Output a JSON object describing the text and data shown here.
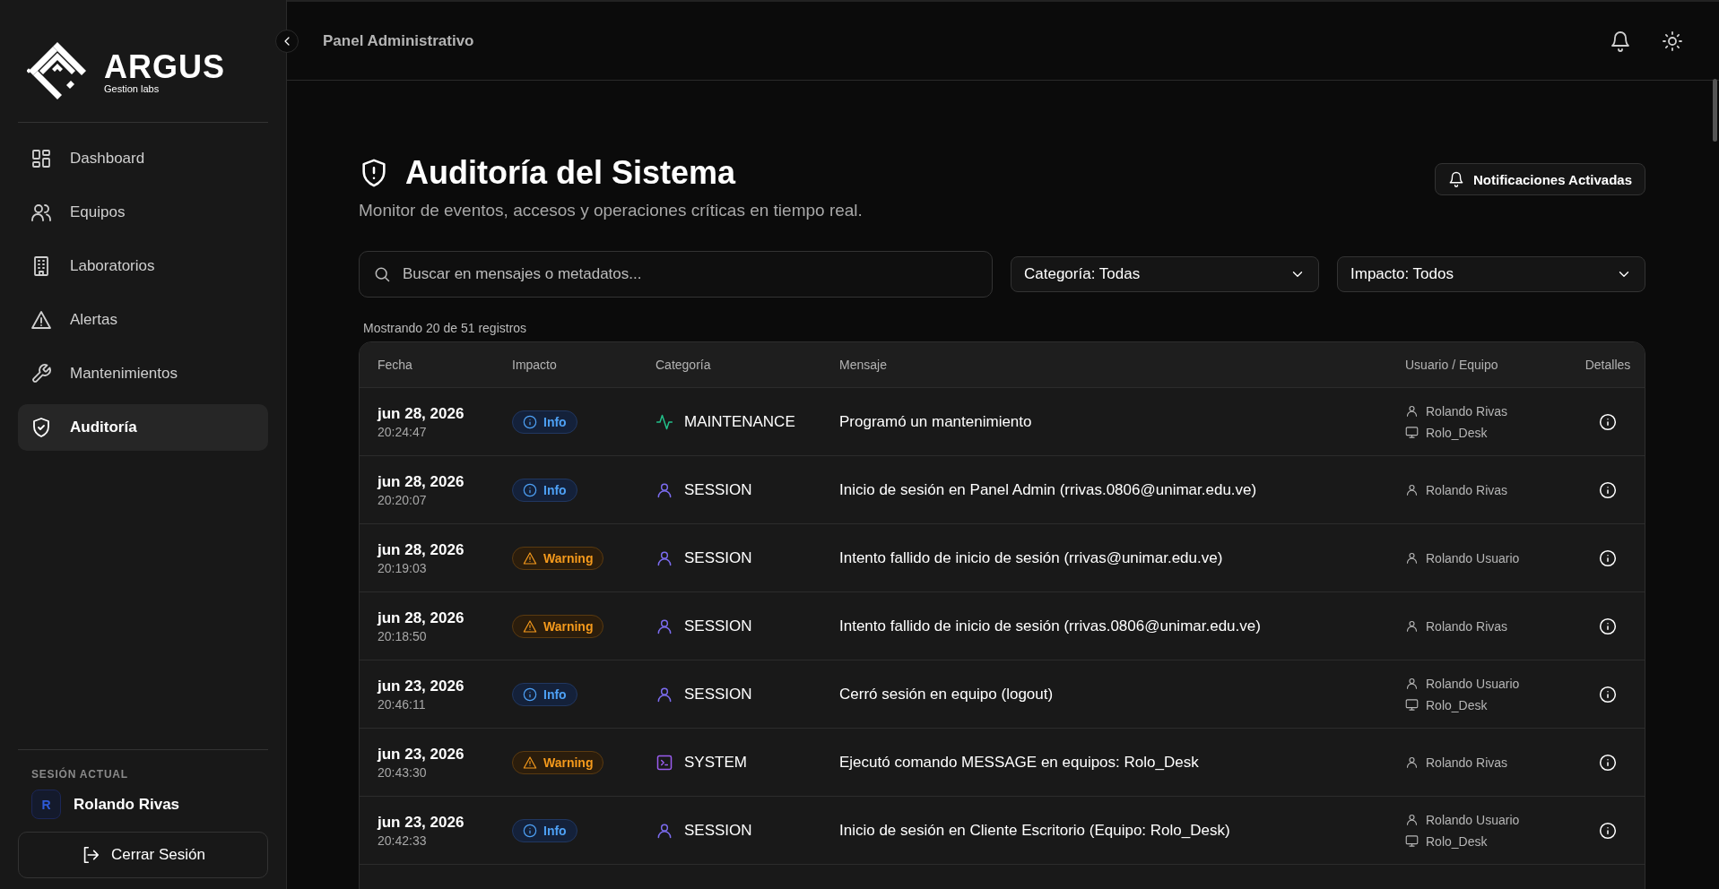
{
  "brand": {
    "name": "ARGUS",
    "tagline": "Gestion labs"
  },
  "sidebar": {
    "items": [
      {
        "label": "Dashboard",
        "selected": false
      },
      {
        "label": "Equipos",
        "selected": false
      },
      {
        "label": "Laboratorios",
        "selected": false
      },
      {
        "label": "Alertas",
        "selected": false
      },
      {
        "label": "Mantenimientos",
        "selected": false
      },
      {
        "label": "Auditoría",
        "selected": true
      }
    ],
    "session_label": "SESIÓN ACTUAL",
    "user_initial": "R",
    "user_name": "Rolando Rivas",
    "logout": "Cerrar Sesión"
  },
  "header": {
    "title": "Panel Administrativo"
  },
  "page": {
    "title": "Auditoría del Sistema",
    "subtitle": "Monitor de eventos, accesos y operaciones críticas en tiempo real.",
    "notify_button": "Notificaciones Activadas",
    "search": {
      "placeholder": "Buscar en mensajes o metadatos..."
    },
    "filters": [
      "Categoría: Todas",
      "Impacto: Todos"
    ],
    "count": "Mostrando 20 de 51 registros"
  },
  "table": {
    "columns": [
      "Fecha",
      "Impacto",
      "Categoría",
      "Mensaje",
      "Usuario / Equipo",
      "Detalles"
    ],
    "rows": [
      {
        "date": "jun 28, 2026",
        "time": "20:24:47",
        "impact": {
          "label": "Info",
          "kind": "info"
        },
        "category": {
          "label": "MAINTENANCE",
          "kind": "activity",
          "color": "#22c08a"
        },
        "message": "Programó un mantenimiento",
        "user": "Rolando Rivas",
        "device": "Rolo_Desk"
      },
      {
        "date": "jun 28, 2026",
        "time": "20:20:07",
        "impact": {
          "label": "Info",
          "kind": "info"
        },
        "category": {
          "label": "SESSION",
          "kind": "user",
          "color": "#7c6cf0"
        },
        "message": "Inicio de sesión en Panel Admin (rrivas.0806@unimar.edu.ve)",
        "user": "Rolando Rivas"
      },
      {
        "date": "jun 28, 2026",
        "time": "20:19:03",
        "impact": {
          "label": "Warning",
          "kind": "warning"
        },
        "category": {
          "label": "SESSION",
          "kind": "user",
          "color": "#7c6cf0"
        },
        "message": "Intento fallido de inicio de sesión (rrivas@unimar.edu.ve)",
        "user": "Rolando Usuario"
      },
      {
        "date": "jun 28, 2026",
        "time": "20:18:50",
        "impact": {
          "label": "Warning",
          "kind": "warning"
        },
        "category": {
          "label": "SESSION",
          "kind": "user",
          "color": "#7c6cf0"
        },
        "message": "Intento fallido de inicio de sesión (rrivas.0806@unimar.edu.ve)",
        "user": "Rolando Rivas"
      },
      {
        "date": "jun 23, 2026",
        "time": "20:46:11",
        "impact": {
          "label": "Info",
          "kind": "info"
        },
        "category": {
          "label": "SESSION",
          "kind": "user",
          "color": "#7c6cf0"
        },
        "message": "Cerró sesión en equipo (logout)",
        "user": "Rolando Usuario",
        "device": "Rolo_Desk"
      },
      {
        "date": "jun 23, 2026",
        "time": "20:43:30",
        "impact": {
          "label": "Warning",
          "kind": "warning"
        },
        "category": {
          "label": "SYSTEM",
          "kind": "terminal",
          "color": "#9b5cf0"
        },
        "message": "Ejecutó comando MESSAGE en equipos: Rolo_Desk",
        "user": "Rolando Rivas"
      },
      {
        "date": "jun 23, 2026",
        "time": "20:42:33",
        "impact": {
          "label": "Info",
          "kind": "info"
        },
        "category": {
          "label": "SESSION",
          "kind": "user",
          "color": "#7c6cf0"
        },
        "message": "Inicio de sesión en Cliente Escritorio (Equipo: Rolo_Desk)",
        "user": "Rolando Usuario",
        "device": "Rolo_Desk"
      }
    ]
  }
}
